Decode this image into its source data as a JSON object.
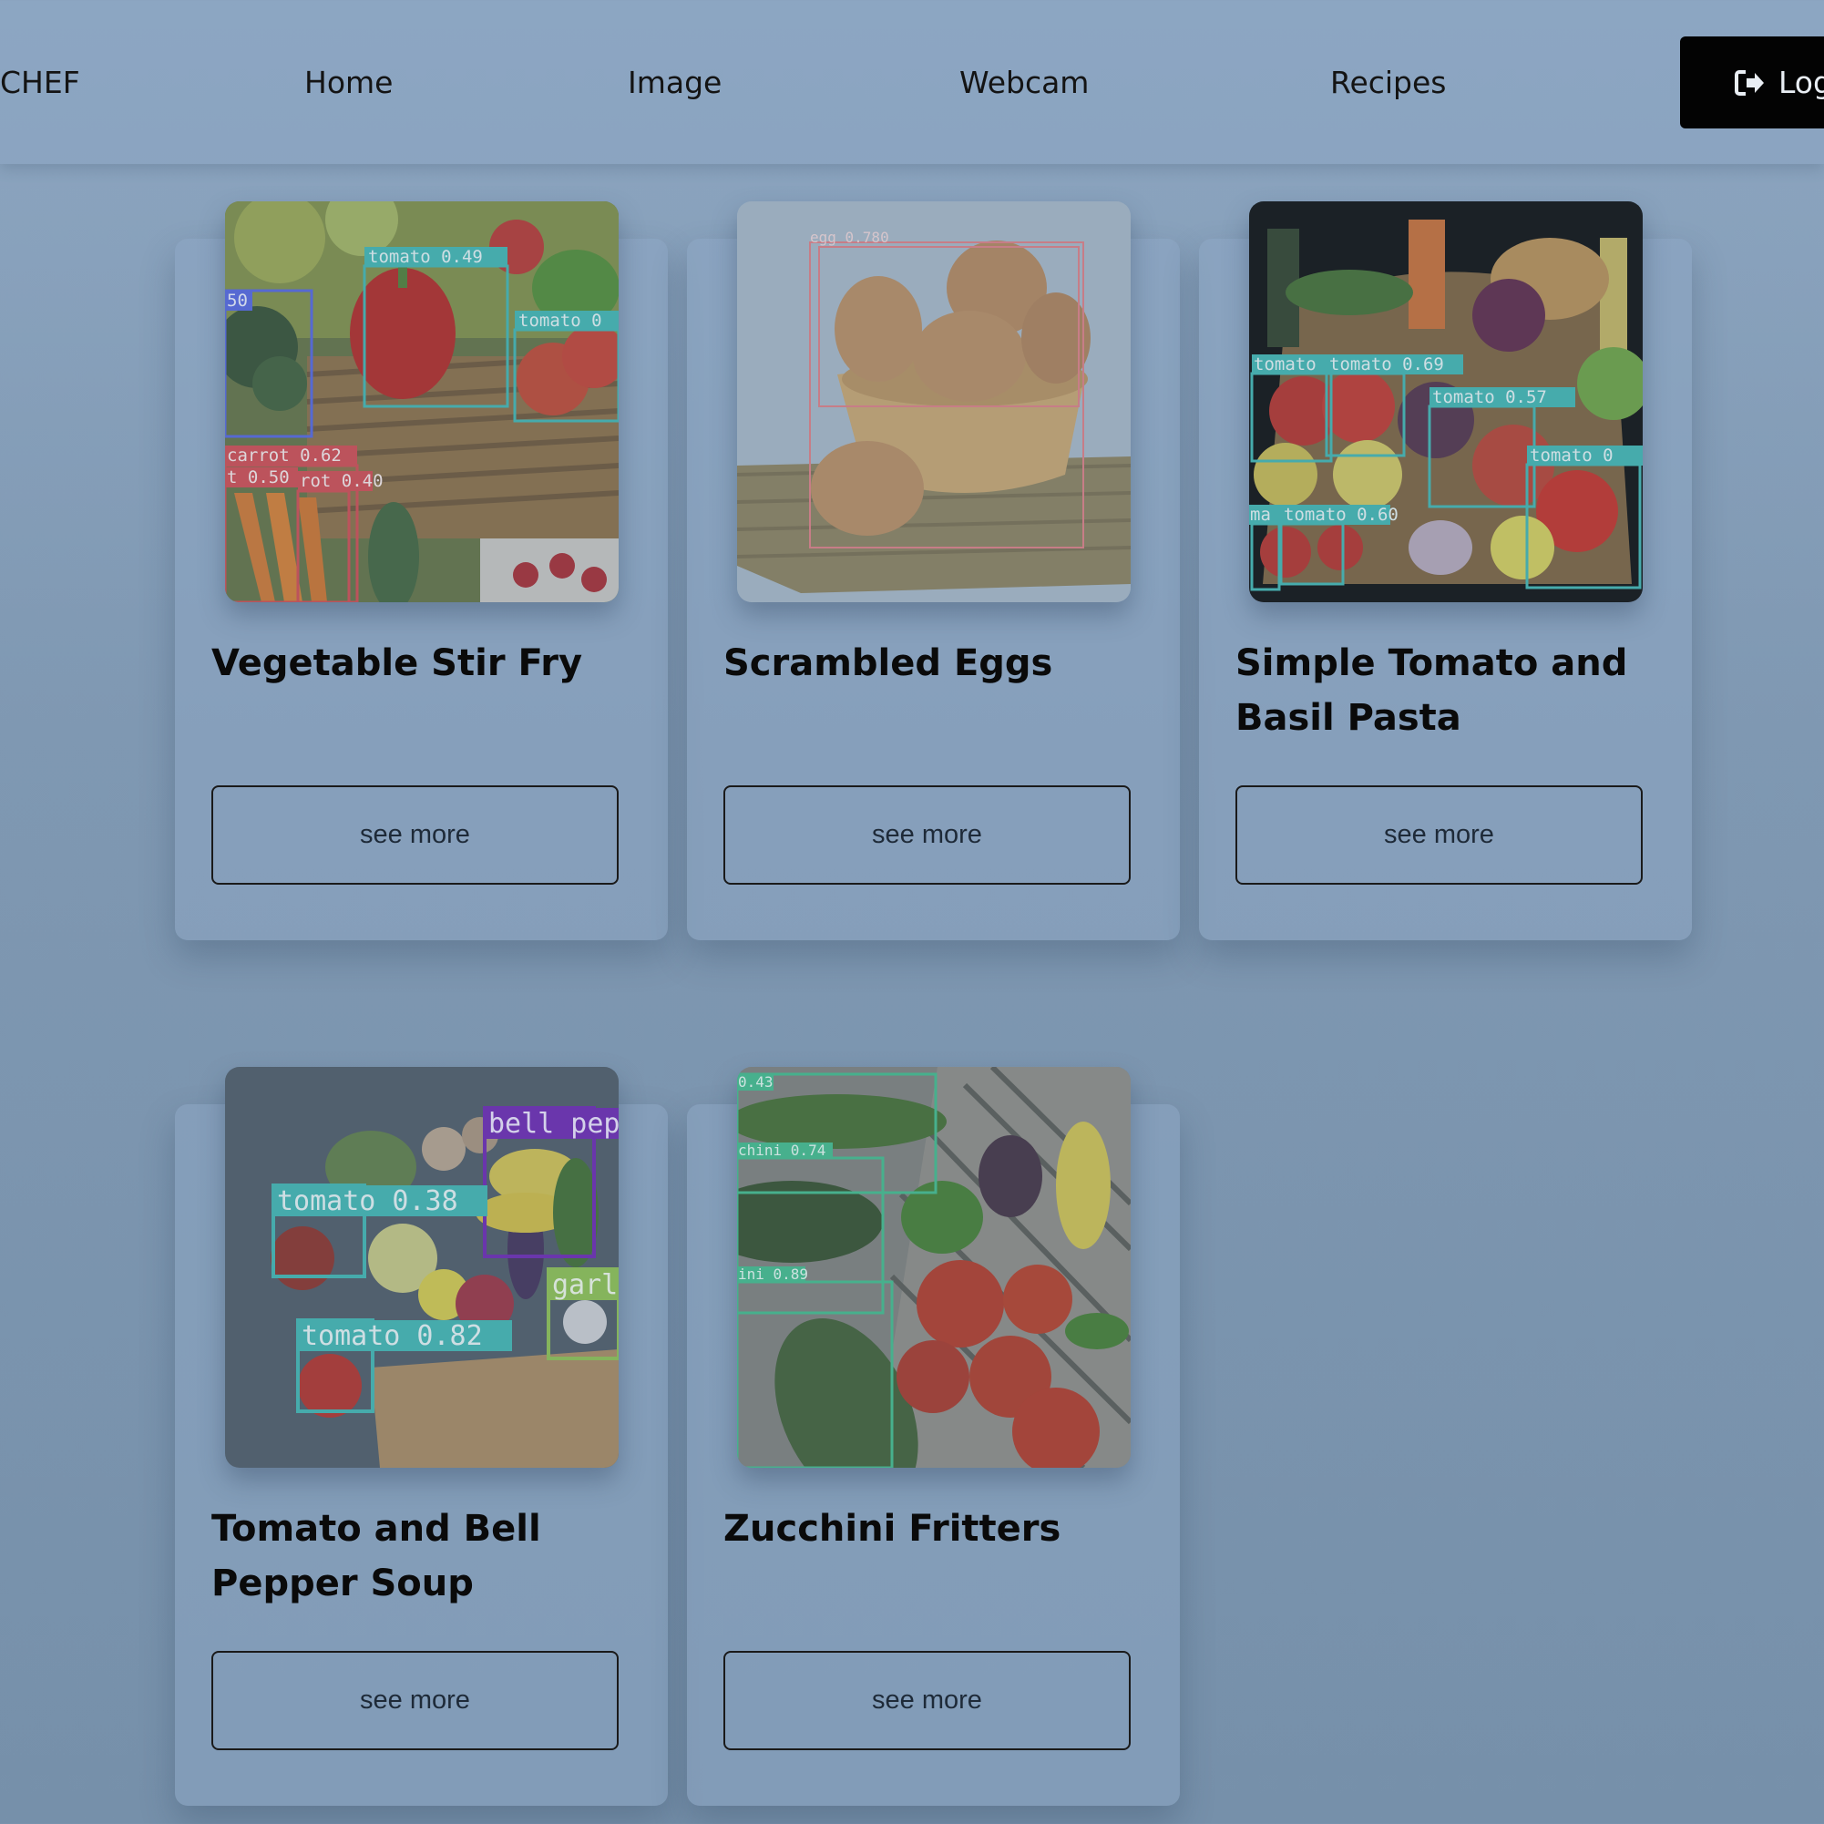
{
  "nav": {
    "brand": "CHEF",
    "items": [
      "Home",
      "Image",
      "Webcam",
      "Recipes"
    ],
    "logout_label": "Log"
  },
  "recipes": [
    {
      "title": "Vegetable Stir Fry",
      "button": "see more",
      "detections": [
        "tomato 0.49",
        "50",
        "tomato 0",
        "carrot 0.62",
        "t 0.50",
        "rot 0.40"
      ]
    },
    {
      "title": "Scrambled Eggs",
      "button": "see more",
      "detections": [
        "egg 0.780"
      ]
    },
    {
      "title": "Simple Tomato and Basil Pasta",
      "button": "see more",
      "detections": [
        "tomato",
        "tomato 0.69",
        "tomato 0.57",
        "tomato 0",
        "ma",
        "tomato 0.60"
      ]
    },
    {
      "title": "Tomato and Bell Pepper Soup",
      "button": "see more",
      "detections": [
        "bell pep",
        "tomato 0.38",
        "garl",
        "tomato 0.82"
      ]
    },
    {
      "title": "Zucchini Fritters",
      "button": "see more",
      "detections": [
        "0.43",
        "chini 0.74",
        "ini 0.89"
      ]
    }
  ],
  "colors": {
    "tomato_box": "#3bb5b0",
    "carrot_box": "#d2454a",
    "broccoli_box": "#5060e0",
    "egg_box": "#e07a80",
    "bell_pepper_box": "#6a1fb0",
    "garlic_box": "#8cc04a",
    "zucchini_box": "#3dbb88"
  },
  "icons": {
    "logout": "sign-out-icon"
  }
}
